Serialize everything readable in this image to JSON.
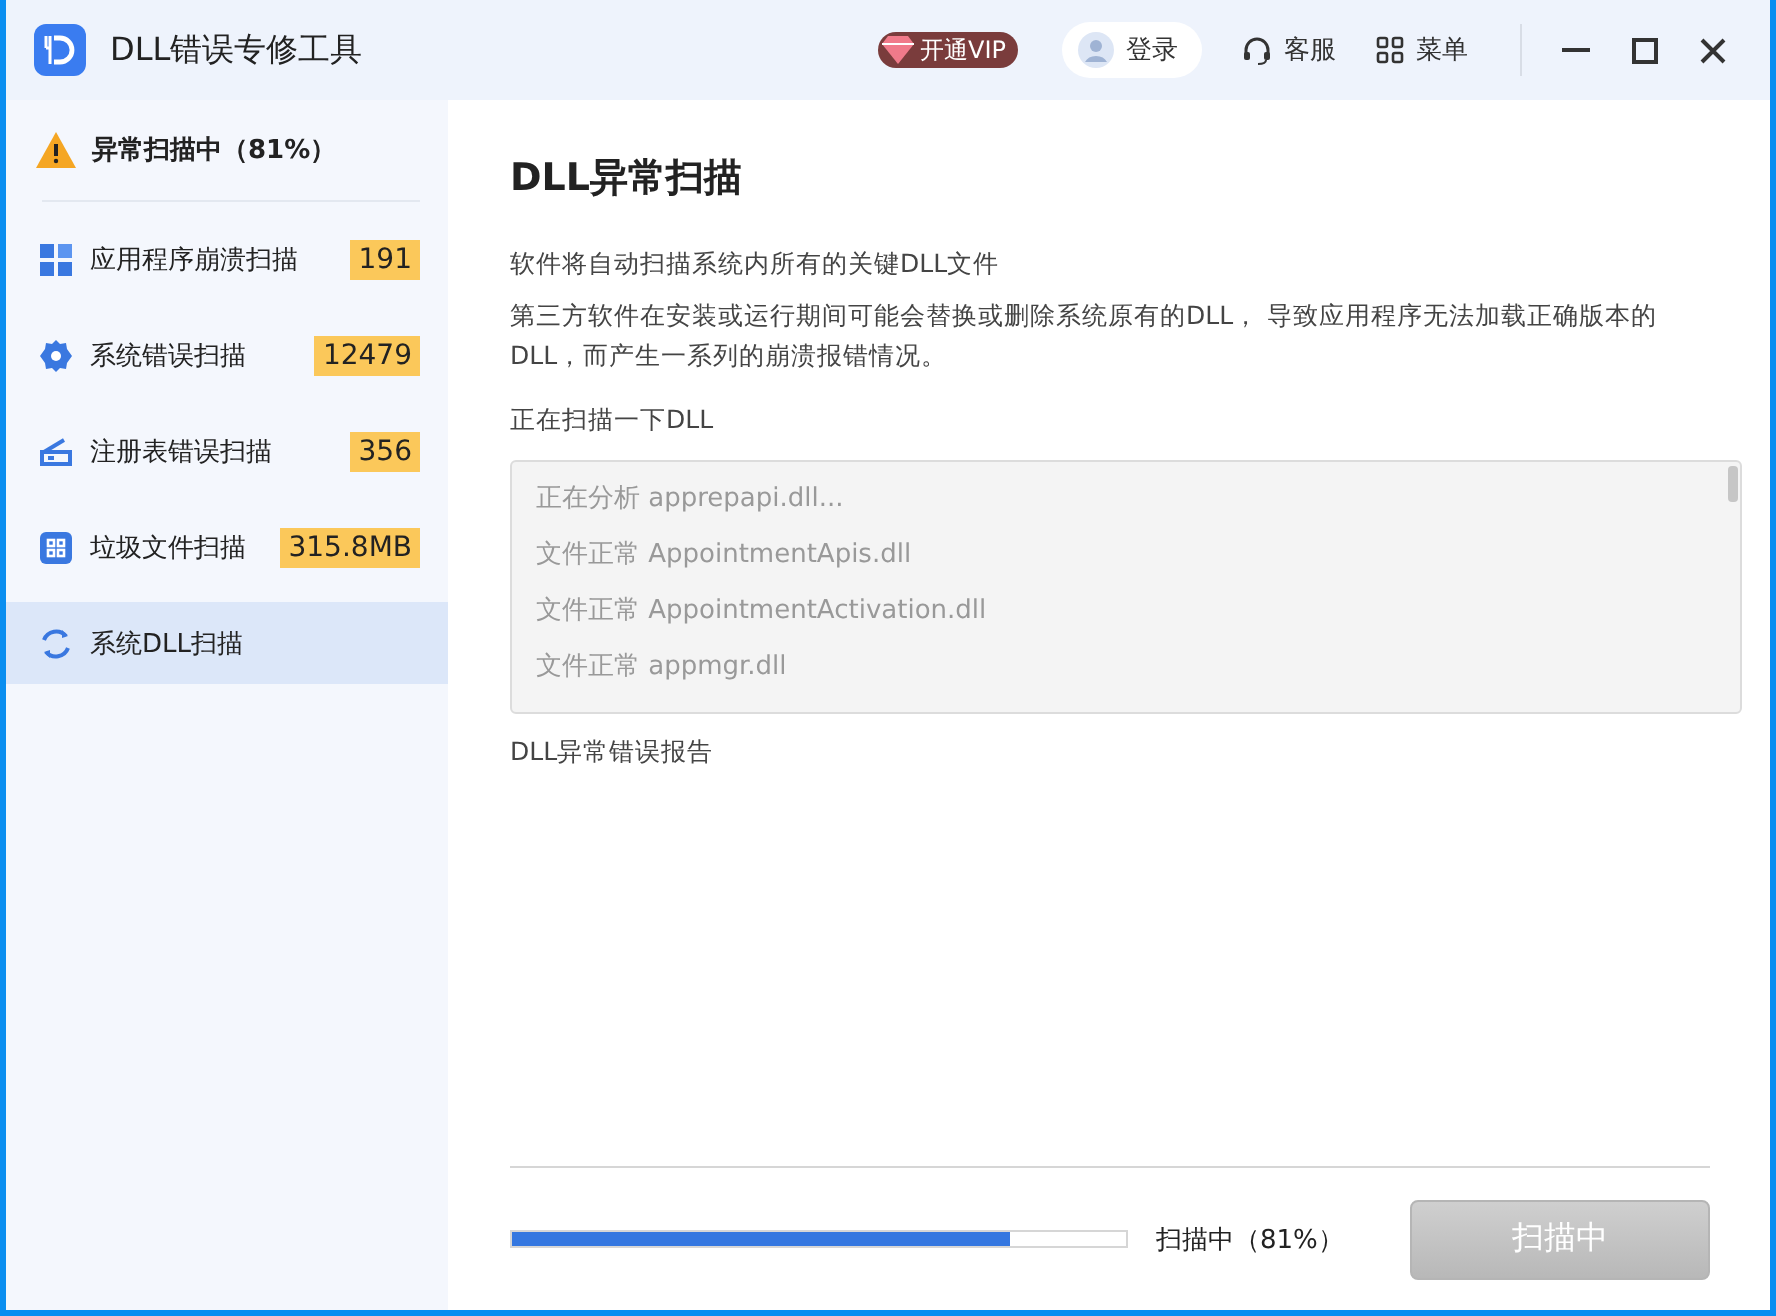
{
  "window": {
    "title": "DLL错误专修工具",
    "vip": "开通VIP",
    "login": "登录",
    "support": "客服",
    "menu": "菜单"
  },
  "sidebar": {
    "status": "异常扫描中（81%）",
    "items": [
      {
        "kind": "grid",
        "label": "应用程序崩溃扫描",
        "count": "191",
        "selected": false
      },
      {
        "kind": "gear",
        "label": "系统错误扫描",
        "count": "12479",
        "selected": false
      },
      {
        "kind": "registry",
        "label": "注册表错误扫描",
        "count": "356",
        "selected": false
      },
      {
        "kind": "apps",
        "label": "垃圾文件扫描",
        "count": "315.8MB",
        "selected": false
      },
      {
        "kind": "refresh",
        "label": "系统DLL扫描",
        "selected": true
      }
    ]
  },
  "content": {
    "title": "DLL异常扫描",
    "intro": "软件将自动扫描系统内所有的关键DLL文件",
    "description": "第三方软件在安装或运行期间可能会替换或删除系统原有的DLL， 导致应用程序无法加载正确版本的DLL，而产生一系列的崩溃报错情况。",
    "scan_label": "正在扫描一下DLL",
    "log": [
      "正在分析 apprepapi.dll...",
      "文件正常 AppointmentApis.dll",
      "文件正常 AppointmentActivation.dll",
      "文件正常 appmgr.dll"
    ],
    "report_label": "DLL异常错误报告"
  },
  "footer": {
    "progress": {
      "level": 0.81
    },
    "status": "扫描中（81%）",
    "button": {
      "label": "扫描中",
      "disabled": true
    }
  }
}
